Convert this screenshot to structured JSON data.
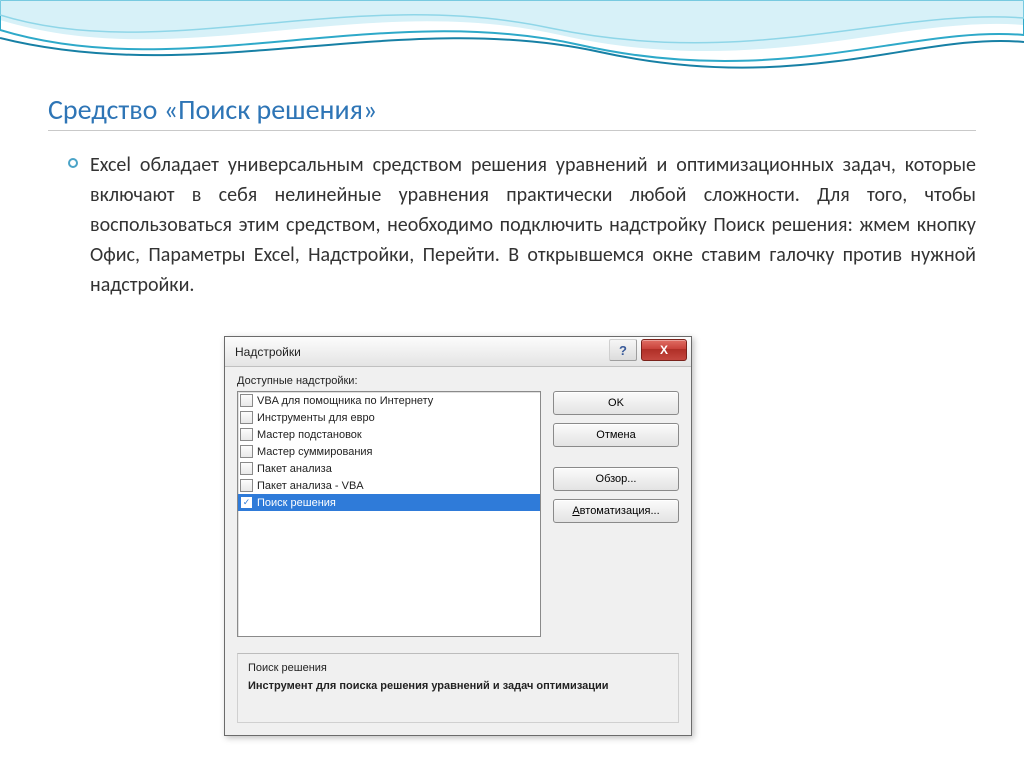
{
  "slide": {
    "title": "Средство «Поиск решения»",
    "bullet": "Excel обладает универсальным средством решения уравнений и оптимизационных задач, которые включают в себя нелинейные уравнения практически любой сложности. Для того, чтобы воспользоваться этим средством, необходимо подключить надстройку Поиск решения: жмем кнопку Офис, Параметры Excel, Надстройки, Перейти. В открывшемся окне ставим галочку против нужной надстройки."
  },
  "dialog": {
    "title": "Надстройки",
    "help_glyph": "?",
    "close_glyph": "X",
    "label": "Доступные надстройки:",
    "items": [
      {
        "label": "VBA для помощника по Интернету",
        "checked": false,
        "selected": false
      },
      {
        "label": "Инструменты для евро",
        "checked": false,
        "selected": false
      },
      {
        "label": "Мастер подстановок",
        "checked": false,
        "selected": false
      },
      {
        "label": "Мастер суммирования",
        "checked": false,
        "selected": false
      },
      {
        "label": "Пакет анализа",
        "checked": false,
        "selected": false
      },
      {
        "label": "Пакет анализа - VBA",
        "checked": false,
        "selected": false
      },
      {
        "label": "Поиск решения",
        "checked": true,
        "selected": true
      }
    ],
    "buttons": {
      "ok": "OK",
      "cancel": "Отмена",
      "browse": "Обзор...",
      "automation_prefix": "А",
      "automation_rest": "втоматизация..."
    },
    "description": {
      "title": "Поиск решения",
      "text": "Инструмент для поиска решения уравнений и задач оптимизации"
    }
  }
}
